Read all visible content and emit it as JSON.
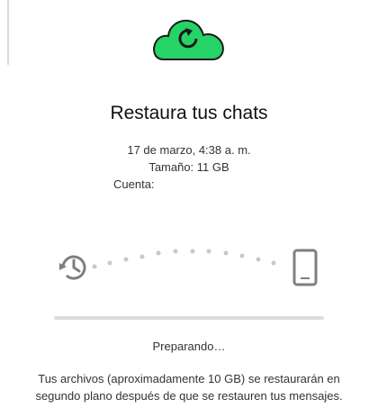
{
  "restore": {
    "title": "Restaura tus chats",
    "date": "17 de marzo, 4:38 a. m.",
    "size": "Tamaño: 11 GB",
    "account_label": "Cuenta:",
    "account_value": "",
    "status": "Preparando…",
    "progress": 0,
    "note": "Tus archivos (aproximadamente 10 GB) se restaurarán en segundo plano después de que se restauren tus mensajes."
  },
  "colors": {
    "accent": "#25d366",
    "icon_gray": "#7f7f7f",
    "track": "#dcdcdc"
  },
  "icons": {
    "cloud": "cloud-restore-icon",
    "history": "history-icon",
    "phone": "phone-icon"
  }
}
